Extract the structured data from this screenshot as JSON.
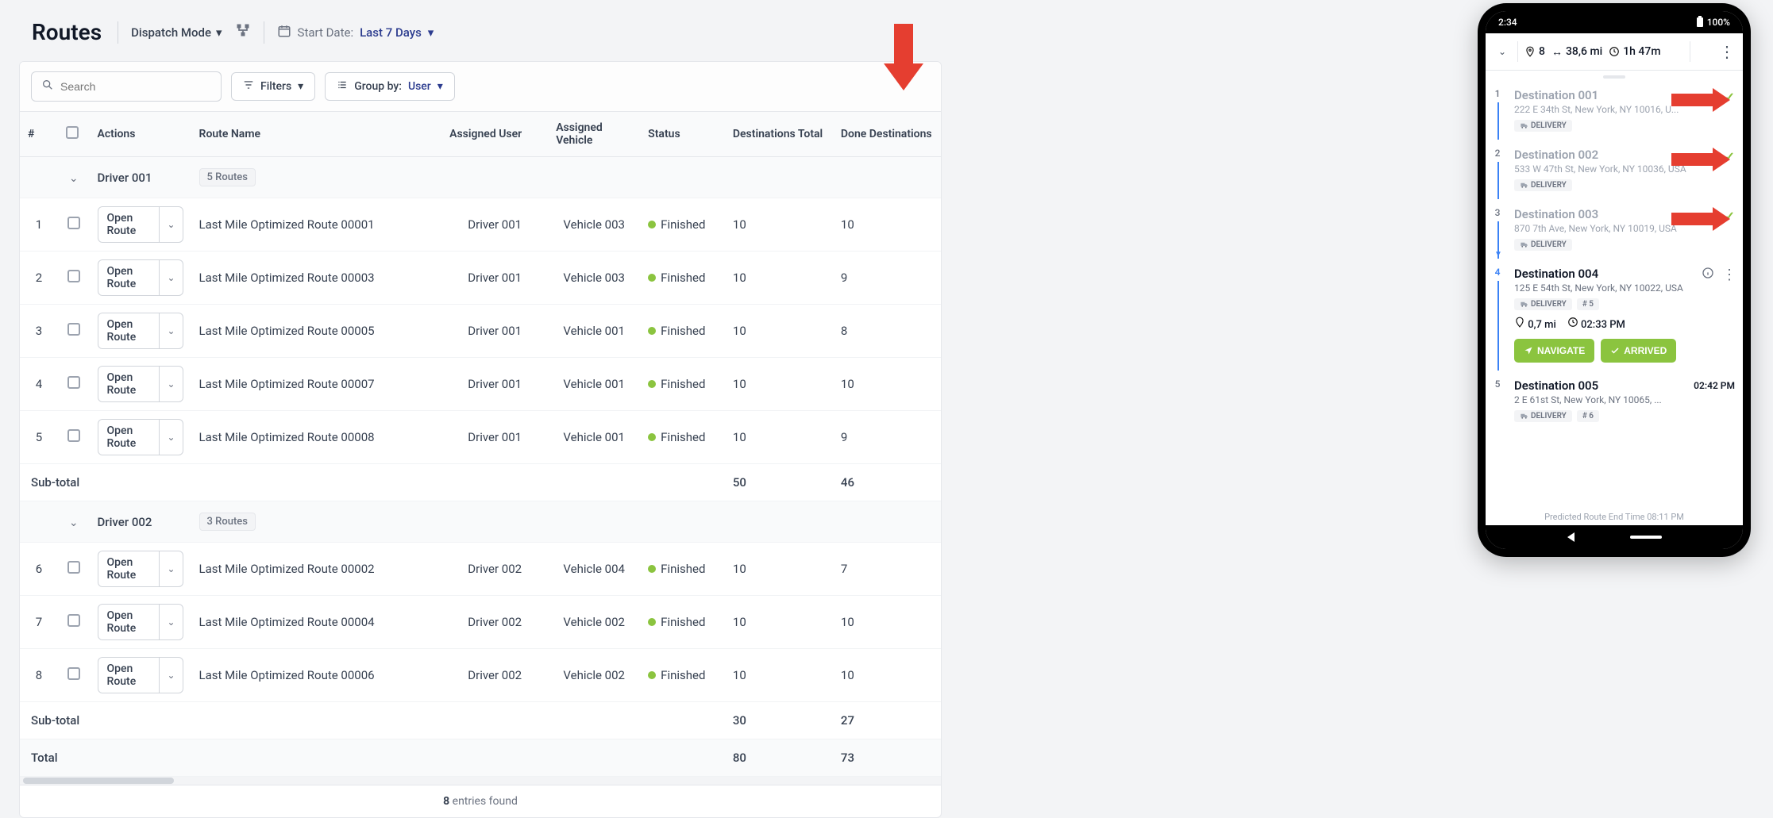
{
  "header": {
    "title": "Routes",
    "dispatch_label": "Dispatch Mode",
    "start_date_label": "Start Date:",
    "start_date_value": "Last 7 Days"
  },
  "toolbar": {
    "search_placeholder": "Search",
    "filters_label": "Filters",
    "groupby_prefix": "Group by:",
    "groupby_value": "User"
  },
  "columns": {
    "num": "#",
    "actions": "Actions",
    "route_name": "Route Name",
    "assigned_user": "Assigned User",
    "assigned_vehicle": "Assigned Vehicle",
    "status": "Status",
    "dest_total": "Destinations Total",
    "done_dest": "Done Destinations"
  },
  "open_route_label": "Open Route",
  "status_finished": "Finished",
  "groups": [
    {
      "driver": "Driver 001",
      "routes_badge": "5 Routes",
      "rows": [
        {
          "num": "1",
          "name": "Last Mile Optimized Route 00001",
          "user": "Driver 001",
          "vehicle": "Vehicle 003",
          "status": "Finished",
          "dt": "10",
          "dd": "10"
        },
        {
          "num": "2",
          "name": "Last Mile Optimized Route 00003",
          "user": "Driver 001",
          "vehicle": "Vehicle 003",
          "status": "Finished",
          "dt": "10",
          "dd": "9"
        },
        {
          "num": "3",
          "name": "Last Mile Optimized Route 00005",
          "user": "Driver 001",
          "vehicle": "Vehicle 001",
          "status": "Finished",
          "dt": "10",
          "dd": "8"
        },
        {
          "num": "4",
          "name": "Last Mile Optimized Route 00007",
          "user": "Driver 001",
          "vehicle": "Vehicle 001",
          "status": "Finished",
          "dt": "10",
          "dd": "10"
        },
        {
          "num": "5",
          "name": "Last Mile Optimized Route 00008",
          "user": "Driver 001",
          "vehicle": "Vehicle 001",
          "status": "Finished",
          "dt": "10",
          "dd": "9"
        }
      ],
      "subtotal": {
        "label": "Sub-total",
        "dt": "50",
        "dd": "46"
      }
    },
    {
      "driver": "Driver 002",
      "routes_badge": "3 Routes",
      "rows": [
        {
          "num": "6",
          "name": "Last Mile Optimized Route 00002",
          "user": "Driver 002",
          "vehicle": "Vehicle 004",
          "status": "Finished",
          "dt": "10",
          "dd": "7"
        },
        {
          "num": "7",
          "name": "Last Mile Optimized Route 00004",
          "user": "Driver 002",
          "vehicle": "Vehicle 002",
          "status": "Finished",
          "dt": "10",
          "dd": "10"
        },
        {
          "num": "8",
          "name": "Last Mile Optimized Route 00006",
          "user": "Driver 002",
          "vehicle": "Vehicle 002",
          "status": "Finished",
          "dt": "10",
          "dd": "10"
        }
      ],
      "subtotal": {
        "label": "Sub-total",
        "dt": "30",
        "dd": "27"
      }
    }
  ],
  "total": {
    "label": "Total",
    "dt": "80",
    "dd": "73"
  },
  "footer": {
    "count": "8",
    "suffix": " entries found"
  },
  "phone": {
    "status_time": "2:34",
    "battery": "100%",
    "top": {
      "stops": "8",
      "distance": "38,6 mi",
      "duration": "1h 47m"
    },
    "destinations": [
      {
        "num": "1",
        "title": "Destination 001",
        "addr": "222 E 34th St, New York, NY 10016, U...",
        "tag": "DELIVERY",
        "done": true
      },
      {
        "num": "2",
        "title": "Destination 002",
        "addr": "533 W 47th St, New York, NY 10036, USA",
        "tag": "DELIVERY",
        "done": true
      },
      {
        "num": "3",
        "title": "Destination 003",
        "addr": "870 7th Ave, New York, NY 10019, USA",
        "tag": "DELIVERY",
        "done": true
      },
      {
        "num": "4",
        "title": "Destination 004",
        "addr": "125 E 54th St, New York, NY 10022, USA",
        "tag": "DELIVERY",
        "seq": "# 5",
        "dist": "0,7 mi",
        "eta": "02:33 PM",
        "active": true
      },
      {
        "num": "5",
        "title": "Destination 005",
        "addr": "2 E 61st St, New York, NY 10065, ...",
        "tag": "DELIVERY",
        "seq": "# 6",
        "time": "02:42 PM"
      }
    ],
    "navigate_label": "NAVIGATE",
    "arrived_label": "ARRIVED",
    "predicted": "Predicted Route End Time 08:11 PM"
  }
}
